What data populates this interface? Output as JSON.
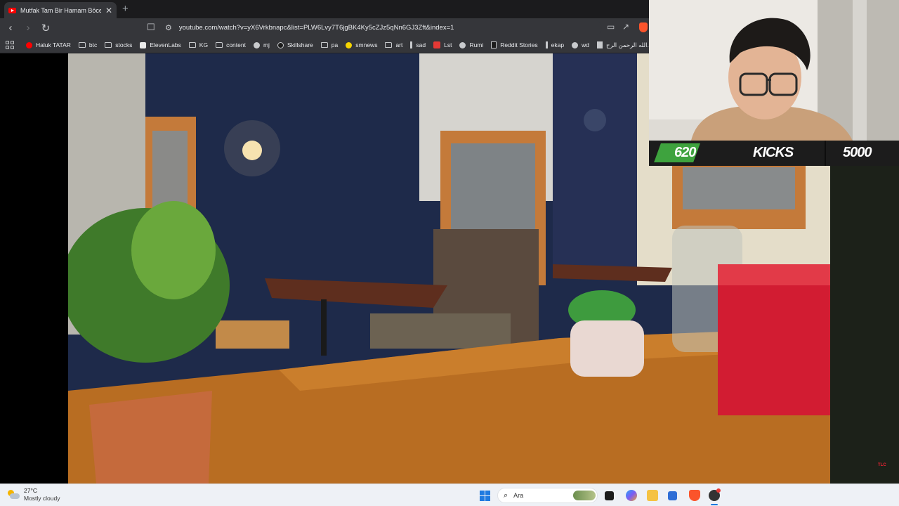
{
  "browser": {
    "tab": {
      "title": "Mutfak Tam Bir Hamam Böceği Yuvası",
      "close_glyph": "✕"
    },
    "new_tab_glyph": "+",
    "nav": {
      "back": "‹",
      "forward": "›",
      "reload": "↻",
      "bookmark": "☐"
    },
    "url": "youtube.com/watch?v=yX6Vrkbnapc&list=PLW6Lvy7T6jgBK4Ky5cZJz5qNn6GJ3Zft&index=1",
    "bookmarks": [
      {
        "label": "Haluk TATAR",
        "icon": "youtube-icon"
      },
      {
        "label": "btc",
        "icon": "folder-icon"
      },
      {
        "label": "stocks",
        "icon": "folder-icon"
      },
      {
        "label": "ElevenLabs",
        "icon": "elevenlabs-icon"
      },
      {
        "label": "KG",
        "icon": "folder-icon"
      },
      {
        "label": "content",
        "icon": "folder-icon"
      },
      {
        "label": "mj",
        "icon": "github-icon"
      },
      {
        "label": "Skillshare",
        "icon": "skillshare-icon"
      },
      {
        "label": "pa",
        "icon": "folder-icon"
      },
      {
        "label": "smnews",
        "icon": "smiley-icon"
      },
      {
        "label": "art",
        "icon": "folder-icon"
      },
      {
        "label": "sad",
        "icon": "v-icon"
      },
      {
        "label": "Lst",
        "icon": "s-logo-icon"
      },
      {
        "label": "Rumi",
        "icon": "globe-icon"
      },
      {
        "label": "Reddit Stories",
        "icon": "d-logo-icon"
      },
      {
        "label": "ekap",
        "icon": "bird-icon"
      },
      {
        "label": "wd",
        "icon": "wordpress-icon"
      },
      {
        "label": "الله الرحمن الرح...",
        "icon": "book-icon"
      }
    ]
  },
  "overlay": {
    "kicks_count": "620",
    "kicks_label": "KICKS",
    "kicks_goal": "5000",
    "watermark": "TLC"
  },
  "taskbar": {
    "weather_temp": "27°C",
    "weather_condition": "Mostly cloudy",
    "search_placeholder": "Ara",
    "search_glyph": "⌕"
  },
  "colors": {
    "brand_youtube": "#ff0000",
    "kicks_green": "#3ea33e",
    "windows_accent": "#1f7ae0"
  }
}
